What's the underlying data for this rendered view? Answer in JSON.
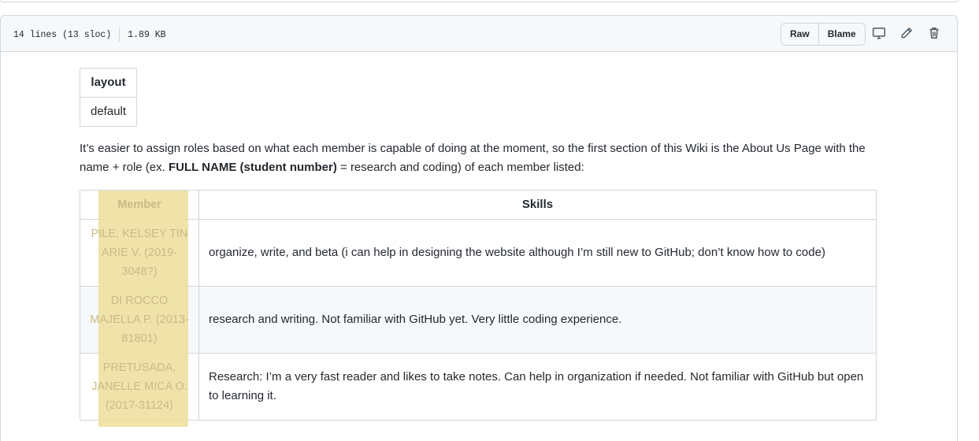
{
  "file_header": {
    "lines_info": "14 lines (13 sloc)",
    "size": "1.89 KB",
    "buttons": {
      "raw": "Raw",
      "blame": "Blame"
    },
    "icons": [
      "desktop-icon",
      "pencil-icon",
      "trash-icon"
    ]
  },
  "front_matter": {
    "header": "layout",
    "value": "default"
  },
  "intro": {
    "part1": "It’s easier to assign roles based on what each member is capable of doing at the moment, so the first section of this Wiki is the About Us Page with the name + role (ex. ",
    "bold": "FULL NAME (student number)",
    "part2": " = research and coding) of each member listed:"
  },
  "members_table": {
    "headers": {
      "member": "Member",
      "skills": "Skills"
    },
    "rows": [
      {
        "member": "PILE, KELSEY TIN ARIE V. (2019-3048?)",
        "skills": "organize, write, and beta (i can help in designing the website although I’m still new to GitHub; don’t know how to code)"
      },
      {
        "member": "DI ROCCO MAJELLA P. (2013-81801)",
        "skills": "research and writing. Not familiar with GitHub yet. Very little coding experience."
      },
      {
        "member": "PRETUSADA, JANELLE MICA O. (2017-31124)",
        "skills": "Research: I’m a very fast reader and likes to take notes. Can help in organization if needed. Not familiar with GitHub but open to learning it."
      }
    ]
  },
  "colors": {
    "highlight": "#eedf9d",
    "border": "#d0d7de",
    "header_bg": "#f6f8fa"
  }
}
